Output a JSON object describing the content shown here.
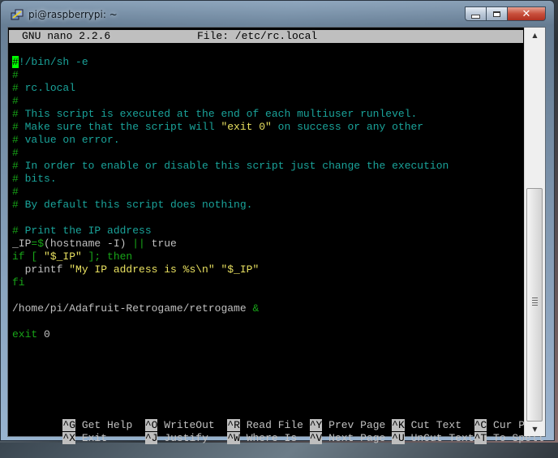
{
  "window": {
    "title": "pi@raspberrypi: ~",
    "icon": "putty-icon",
    "controls": {
      "minimize": "minimize",
      "maximize": "maximize",
      "close": "✕"
    }
  },
  "nano": {
    "header_left": "GNU nano 2.2.6",
    "header_center": "File: /etc/rc.local",
    "cursor_char": "#",
    "lines": {
      "l1": "!/bin/sh -e",
      "l2_hash": "#",
      "l3_hash": "#",
      "l3": " rc.local",
      "l4_hash": "#",
      "l5_hash": "#",
      "l5": " This script is executed at the end of each multiuser runlevel.",
      "l6_hash": "#",
      "l6a": " Make sure that the script will ",
      "l6b": "\"exit 0\"",
      "l6c": " on success or any other",
      "l7_hash": "#",
      "l7": " value on error.",
      "l8_hash": "#",
      "l9_hash": "#",
      "l9": " In order to enable or disable this script just change the execution",
      "l10_hash": "#",
      "l10": " bits.",
      "l11_hash": "#",
      "l12_hash": "#",
      "l12": " By default this script does nothing.",
      "l14_hash": "#",
      "l14": " Print the IP address",
      "l15a": "_IP",
      "l15b": "=$",
      "l15c": "(hostname -I) ",
      "l15d": "||",
      "l15e": " true",
      "l16a": "if [ ",
      "l16b": "\"$_IP\"",
      "l16c": " ]; then",
      "l17a": "  printf ",
      "l17b": "\"My IP address is %s\\n\" \"$_IP\"",
      "l18": "fi",
      "l20a": "/home/pi/Adafruit-Retrogame/retrogame ",
      "l20b": "&",
      "l22a": "exit",
      "l22b": " 0"
    },
    "shortcuts": [
      {
        "key": "^G",
        "label": " Get Help  "
      },
      {
        "key": "^O",
        "label": " WriteOut  "
      },
      {
        "key": "^R",
        "label": " Read File "
      },
      {
        "key": "^Y",
        "label": " Prev Page "
      },
      {
        "key": "^K",
        "label": " Cut Text  "
      },
      {
        "key": "^C",
        "label": " Cur Pos"
      },
      {
        "key": "^X",
        "label": " Exit      "
      },
      {
        "key": "^J",
        "label": " Justify   "
      },
      {
        "key": "^W",
        "label": " Where Is  "
      },
      {
        "key": "^V",
        "label": " Next Page "
      },
      {
        "key": "^U",
        "label": " UnCut Text"
      },
      {
        "key": "^T",
        "label": " To Spell"
      }
    ]
  },
  "scrollbar": {
    "up": "▲",
    "down": "▼",
    "position": 0.96
  },
  "colors": {
    "header_bg": "#bfbfbf",
    "comment": "#1aa39a",
    "hash": "#17a517",
    "string": "#e8e060",
    "keyword": "#18a518",
    "cursor": "#00ff00"
  }
}
